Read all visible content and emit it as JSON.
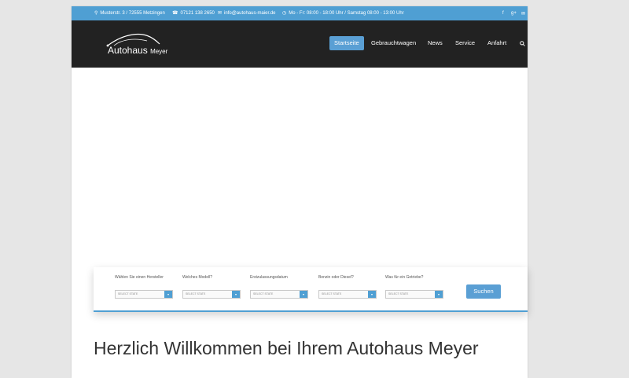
{
  "topbar": {
    "address": "Musterstr. 3 / 72555 Metzingen",
    "phone": "07121 138 2650",
    "email": "info@autohaus-maier.de",
    "hours": "Mo - Fr: 08:00 - 18:00 Uhr / Samstag 08:00 - 13:00 Uhr",
    "social": [
      "f",
      "g+",
      "✉"
    ]
  },
  "logo": {
    "main": "Autohaus",
    "sub": "Meyer"
  },
  "nav": {
    "items": [
      "Startseite",
      "Gebrauchtwagen",
      "News",
      "Service",
      "Anfahrt"
    ],
    "active": "Startseite"
  },
  "search": {
    "fields": [
      {
        "label": "Wählen Sie einen Hersteller",
        "value": "SELECT STATE"
      },
      {
        "label": "Welches Modell?",
        "value": "SELECT STATE"
      },
      {
        "label": "Erstzulassungsdatum",
        "value": "SELECT STATE"
      },
      {
        "label": "Benzin oder Diesel?",
        "value": "SELECT STATE"
      },
      {
        "label": "Was für ein Getriebe?",
        "value": "SELECT STATE"
      }
    ],
    "button": "Suchen"
  },
  "welcome": "Herzlich Willkommen bei Ihrem Autohaus Meyer",
  "colors": {
    "accent": "#4f9fd3",
    "header": "#222222",
    "page_bg": "#e6e6e6"
  }
}
